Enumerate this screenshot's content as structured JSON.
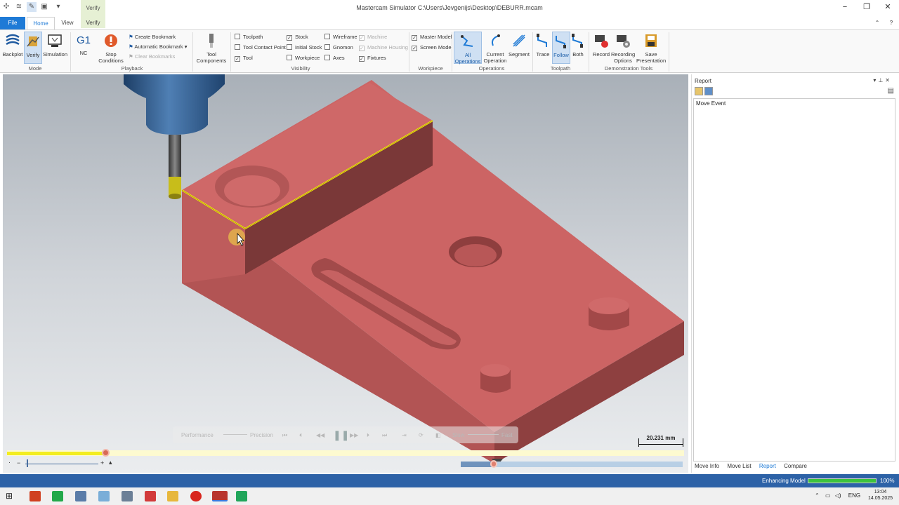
{
  "window": {
    "title": "Mastercam Simulator  C:\\Users\\Jevgenijs\\Desktop\\DEBURR.mcam",
    "context_group": "Verify"
  },
  "tabs": {
    "file": "File",
    "home": "Home",
    "view": "View",
    "verify": "Verify"
  },
  "ribbon": {
    "mode": {
      "group": "Mode",
      "backplot": "Backplot",
      "verify": "Verify",
      "simulation": "Simulation"
    },
    "playback": {
      "group": "Playback",
      "nc_icon": "G1",
      "nc": "NC",
      "stop_conditions": "Stop\nConditions",
      "create_bookmark": "Create Bookmark",
      "automatic_bookmark": "Automatic Bookmark",
      "clear_bookmarks": "Clear Bookmarks"
    },
    "tool_components": "Tool\nComponents",
    "visibility": {
      "group": "Visibility",
      "items": [
        {
          "label": "Toolpath",
          "checked": false,
          "enabled": true
        },
        {
          "label": "Tool Contact Point",
          "checked": false,
          "enabled": true
        },
        {
          "label": "Tool",
          "checked": true,
          "enabled": true
        },
        {
          "label": "Stock",
          "checked": true,
          "enabled": true
        },
        {
          "label": "Initial Stock",
          "checked": false,
          "enabled": true
        },
        {
          "label": "Workpiece",
          "checked": false,
          "enabled": true
        },
        {
          "label": "Wireframe",
          "checked": false,
          "enabled": true
        },
        {
          "label": "Gnomon",
          "checked": false,
          "enabled": true
        },
        {
          "label": "Axes",
          "checked": false,
          "enabled": true
        },
        {
          "label": "Machine",
          "checked": true,
          "enabled": false
        },
        {
          "label": "Machine Housing",
          "checked": true,
          "enabled": false
        },
        {
          "label": "Fixtures",
          "checked": true,
          "enabled": true
        }
      ]
    },
    "workpiece": {
      "group": "Workpiece",
      "master_model": "Master Model",
      "screen_model": "Screen Model",
      "master_checked": true,
      "screen_checked": true
    },
    "operations": {
      "group": "Operations",
      "all": "All\nOperations",
      "current": "Current\nOperation",
      "segment": "Segment"
    },
    "toolpath": {
      "group": "Toolpath",
      "trace": "Trace",
      "follow": "Follow",
      "both": "Both"
    },
    "demo": {
      "group": "Demonstration Tools",
      "record": "Record",
      "recording_options": "Recording\nOptions",
      "save_presentation": "Save\nPresentation"
    }
  },
  "viewport": {
    "scale": "20.231 mm",
    "playbar": {
      "performance": "Performance",
      "precision": "Precision",
      "slow": "Slow",
      "fast": "Fast"
    },
    "progress": 0.145,
    "range_marker": 0.15,
    "zoom_minus": "−",
    "zoom_plus": "+"
  },
  "report": {
    "title": "Report",
    "header": "Move Event",
    "tabs": [
      "Move Info",
      "Move List",
      "Report",
      "Compare"
    ],
    "active_tab": "Report"
  },
  "status": {
    "label": "Enhancing Model",
    "percent_text": "100%",
    "percent": 1.0
  },
  "taskbar": {
    "lang": "ENG",
    "time": "13:04",
    "date": "14.05.2025"
  },
  "colors": {
    "accent": "#1e7ad6",
    "status_bar": "#2d62a7",
    "part": "#c86060",
    "toolpath_highlight": "#f2e218"
  }
}
